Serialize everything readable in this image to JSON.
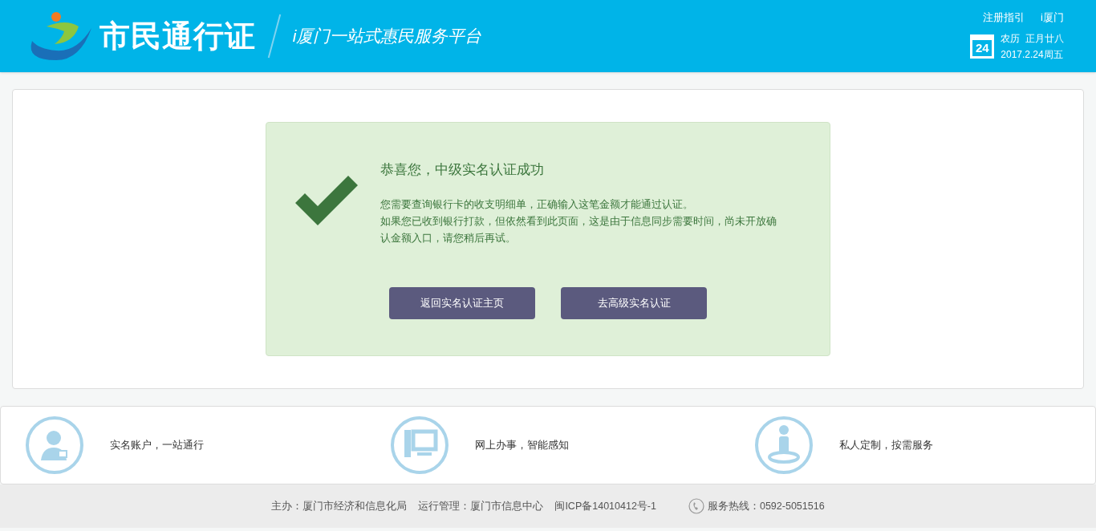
{
  "header": {
    "title": "市民通行证",
    "subtitle": "i厦门一站式惠民服务平台",
    "links": [
      "注册指引",
      "i厦门"
    ],
    "calendar_day": "24",
    "lunar": "农历  正月廿八",
    "date": "2017.2.24周五"
  },
  "message": {
    "title": "恭喜您，中级实名认证成功",
    "lines": [
      "您需要查询银行卡的收支明细单，正确输入这笔金额才能通过认证。",
      "如果您已收到银行打款，但依然看到此页面，这是由于信息同步需要时间，尚未开放确认金额入口，请您稍后再试。"
    ],
    "buttons": [
      "返回实名认证主页",
      "去高级实名认证"
    ]
  },
  "features": [
    {
      "kind": "account",
      "text": "实名账户，一站通行"
    },
    {
      "kind": "computer",
      "text": "网上办事，智能感知"
    },
    {
      "kind": "person",
      "text": "私人定制，按需服务"
    }
  ],
  "footer": {
    "sponsor": "主办：厦门市经济和信息化局",
    "operator": "运行管理：厦门市信息中心",
    "icp": "闽ICP备14010412号-1",
    "hotline": "服务热线：0592-5051516"
  }
}
